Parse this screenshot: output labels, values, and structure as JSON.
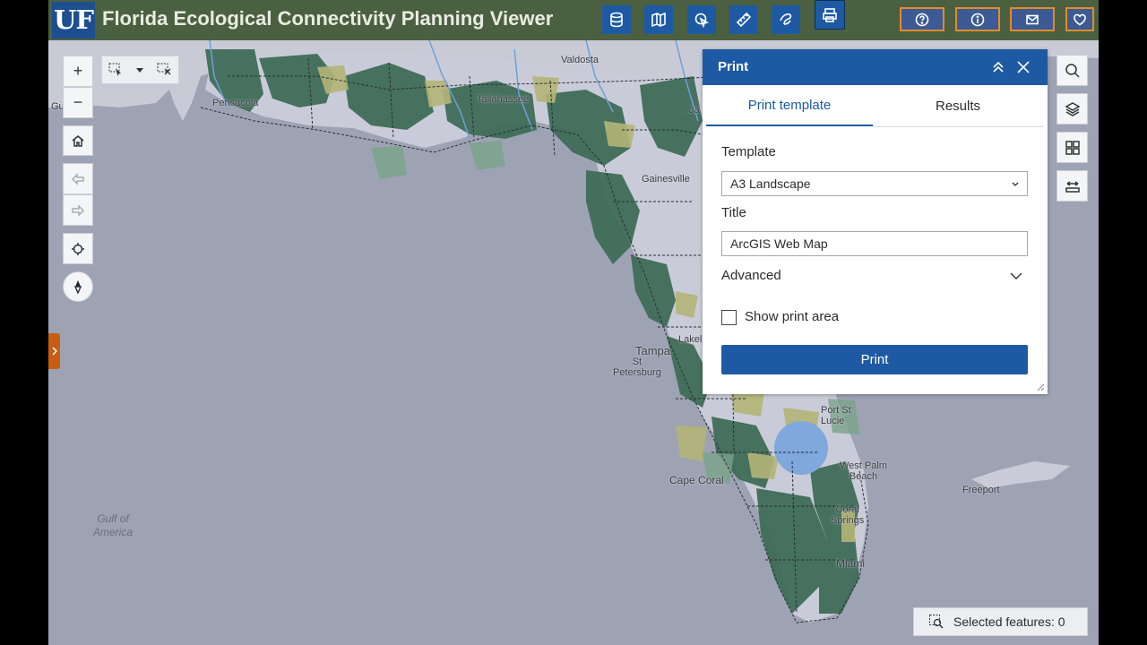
{
  "header": {
    "logo": "UF",
    "title": "Florida Ecological Connectivity Planning Viewer",
    "toolbar_icons": [
      "data-icon",
      "map-icon",
      "pointer-icon",
      "measure-icon",
      "hand-icon",
      "print-icon"
    ],
    "right_icons": [
      "help-icon",
      "info-icon",
      "mail-icon",
      "heart-icon"
    ]
  },
  "map": {
    "labels": {
      "valdosta": "Valdosta",
      "pensacola": "Pensacola",
      "tallahassee": "Tallahassee",
      "gainesville": "Gainesville",
      "tampa": "Tampa",
      "st_petersburg": "St\nPetersburg",
      "lakeland": "Lakel",
      "port_st_lucie": "Port St\nLucie",
      "west_palm_beach": "West Palm\nBeach",
      "cape_coral": "Cape Coral",
      "coral_springs": "Coral\nSprings",
      "miami": "Miami",
      "freeport": "Freeport",
      "gulf_of_america": "Gulf of\nAmerica",
      "gu": "Gu",
      "ja": "Ja"
    }
  },
  "controls": {
    "zoom_in": "+",
    "zoom_out": "−"
  },
  "print_panel": {
    "title": "Print",
    "tabs": [
      {
        "label": "Print template",
        "active": true
      },
      {
        "label": "Results",
        "active": false
      }
    ],
    "template_label": "Template",
    "template_value": "A3 Landscape",
    "title_label": "Title",
    "title_value": "ArcGIS Web Map",
    "advanced_label": "Advanced",
    "show_print_area_label": "Show print area",
    "show_print_area_checked": false,
    "print_button": "Print"
  },
  "status": {
    "selected_features": "Selected features: 0"
  },
  "colors": {
    "header_bg": "#4b6040",
    "accent_blue": "#1d5aa3",
    "map_water": "#9da3b3",
    "land": "#c5c8d4",
    "habitat_dark": "#3f6d58",
    "habitat_light": "#b4b577",
    "orange_border": "#e58a2b"
  }
}
